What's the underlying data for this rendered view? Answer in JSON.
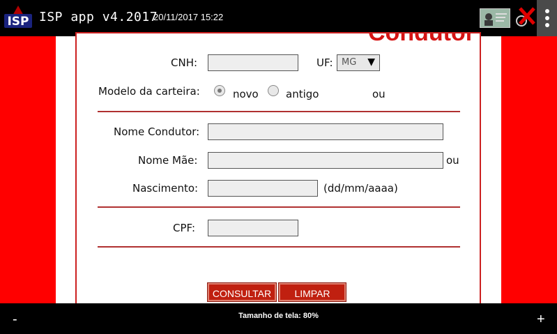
{
  "app": {
    "title": "ISP app v4.2017",
    "datetime": "20/11/2017 15:22",
    "logo_text": "ISP"
  },
  "form": {
    "title": "Condutor",
    "cnh_label": "CNH:",
    "cnh_value": "",
    "uf_label": "UF:",
    "uf_value": "MG",
    "modelo_label": "Modelo da carteira:",
    "modelo_options": [
      "novo",
      "antigo"
    ],
    "modelo_selected": "novo",
    "ou_1": "ou",
    "nome_condutor_label": "Nome Condutor:",
    "nome_condutor_value": "",
    "nome_mae_label": "Nome Mãe:",
    "nome_mae_value": "",
    "ou_2": "ou",
    "nascimento_label": "Nascimento:",
    "nascimento_value": "",
    "nascimento_hint": "(dd/mm/aaaa)",
    "cpf_label": "CPF:",
    "cpf_value": ""
  },
  "buttons": {
    "consultar": "CONSULTAR",
    "limpar": "LIMPAR"
  },
  "bottom": {
    "minus": "-",
    "plus": "+",
    "screen_size": "Tamanho de tela: 80%"
  },
  "colors": {
    "accent_red": "#ff0000",
    "button_red": "#c02010"
  }
}
